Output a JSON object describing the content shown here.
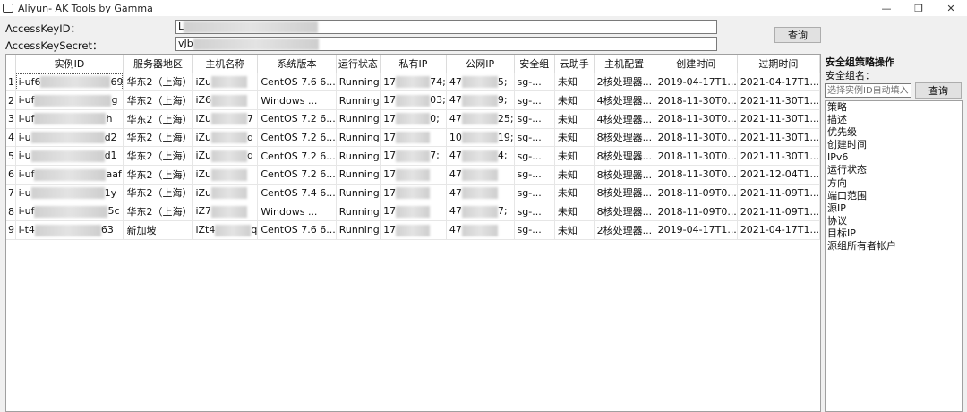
{
  "window": {
    "title": "Aliyun- AK Tools by Gamma",
    "controls": [
      "—",
      "❐",
      "✕"
    ]
  },
  "form": {
    "key_id_label": "AccessKeyID：",
    "key_id_value": "L",
    "key_secret_label": "AccessKeySecret：",
    "key_secret_value": "vJb",
    "query_label": "查询"
  },
  "table": {
    "headers": [
      "",
      "实例ID",
      "服务器地区",
      "主机名称",
      "系统版本",
      "运行状态",
      "私有IP",
      "公网IP",
      "安全组",
      "云助手",
      "主机配置",
      "创建时间",
      "过期时间"
    ],
    "rows": [
      [
        "1",
        "i-uf6",
        "69",
        "华东2（上海）",
        "iZu",
        "",
        "CentOS  7.6 6...",
        "Running",
        "17",
        "74;",
        "47",
        "5;",
        "sg-...",
        "未知",
        "2核处理器...",
        "2019-04-17T1...",
        "2021-04-17T1..."
      ],
      [
        "2",
        "i-uf",
        "g",
        "华东2（上海）",
        "iZ6",
        "",
        "Windows ...",
        "Running",
        "17",
        "03;",
        "47",
        "9;",
        "sg-...",
        "未知",
        "4核处理器...",
        "2018-11-30T0...",
        "2021-11-30T1..."
      ],
      [
        "3",
        "i-uf",
        "h",
        "华东2（上海）",
        "iZu",
        "7",
        "CentOS  7.2 6...",
        "Running",
        "17",
        "0;",
        "47",
        "25;",
        "sg-...",
        "未知",
        "4核处理器...",
        "2018-11-30T0...",
        "2021-11-30T1..."
      ],
      [
        "4",
        "i-u",
        "d2",
        "华东2（上海）",
        "iZu",
        "d",
        "CentOS  7.2 6...",
        "Running",
        "17",
        "",
        "10",
        "19;",
        "sg-...",
        "未知",
        "8核处理器...",
        "2018-11-30T0...",
        "2021-11-30T1..."
      ],
      [
        "5",
        "i-u",
        "d1",
        "华东2（上海）",
        "iZu",
        "d",
        "CentOS  7.2 6...",
        "Running",
        "17",
        "7;",
        "47",
        "4;",
        "sg-...",
        "未知",
        "8核处理器...",
        "2018-11-30T0...",
        "2021-11-30T1..."
      ],
      [
        "6",
        "i-uf",
        "aaf",
        "华东2（上海）",
        "iZu",
        "",
        "CentOS  7.2 6...",
        "Running",
        "17",
        "",
        "47",
        "",
        "sg-...",
        "未知",
        "8核处理器...",
        "2018-11-30T0...",
        "2021-12-04T1..."
      ],
      [
        "7",
        "i-u",
        "1y",
        "华东2（上海）",
        "iZu",
        "",
        "CentOS  7.4 6...",
        "Running",
        "17",
        "",
        "47",
        "",
        "sg-...",
        "未知",
        "8核处理器...",
        "2018-11-09T0...",
        "2021-11-09T1..."
      ],
      [
        "8",
        "i-uf",
        "5c",
        "华东2（上海）",
        "iZ7",
        "",
        "Windows ...",
        "Running",
        "17",
        "",
        "47",
        "7;",
        "sg-...",
        "未知",
        "8核处理器...",
        "2018-11-09T0...",
        "2021-11-09T1..."
      ],
      [
        "9",
        "i-t4",
        "63",
        "新加坡",
        "iZt4",
        "q",
        "CentOS  7.6 6...",
        "Running",
        "17",
        "",
        "47",
        "",
        "sg-...",
        "未知",
        "2核处理器...",
        "2019-04-17T1...",
        "2021-04-17T1..."
      ]
    ]
  },
  "side": {
    "title": "安全组策略操作",
    "group_label": "安全组名：",
    "group_placeholder": "选择实例ID自动填入",
    "query_label": "查询",
    "fields": [
      "策略",
      "描述",
      "优先级",
      "创建时间",
      "IPv6",
      "运行状态",
      "方向",
      "端口范围",
      "源IP",
      "协议",
      "目标IP",
      "源组所有者帐户"
    ]
  }
}
